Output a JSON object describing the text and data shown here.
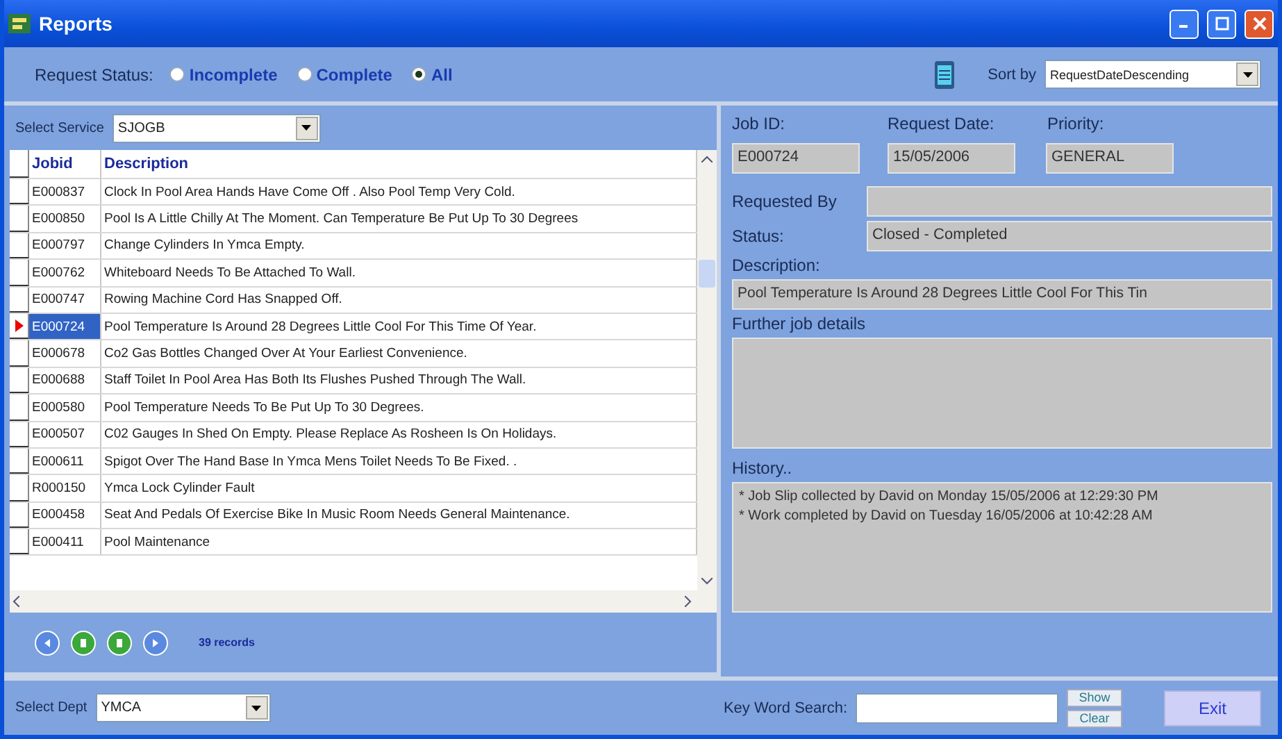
{
  "window": {
    "title": "Reports"
  },
  "request_status": {
    "label": "Request Status:",
    "options": [
      {
        "label": "Incomplete",
        "selected": false
      },
      {
        "label": "Complete",
        "selected": false
      },
      {
        "label": "All",
        "selected": true
      }
    ]
  },
  "sort": {
    "label": "Sort by",
    "value": "RequestDateDescending"
  },
  "service": {
    "label": "Select Service",
    "value": "SJOGB"
  },
  "table": {
    "columns": [
      "Jobid",
      "Description"
    ],
    "rows": [
      {
        "jobid": "E000837",
        "description": "Clock In Pool Area Hands Have Come Off .  Also Pool Temp Very Cold.",
        "selected": false
      },
      {
        "jobid": "E000850",
        "description": "Pool Is A Little Chilly At The Moment.  Can Temperature Be Put Up To 30 Degrees",
        "selected": false
      },
      {
        "jobid": "E000797",
        "description": "Change Cylinders In Ymca Empty.",
        "selected": false
      },
      {
        "jobid": "E000762",
        "description": "Whiteboard Needs To Be Attached To Wall.",
        "selected": false
      },
      {
        "jobid": "E000747",
        "description": "Rowing Machine Cord Has Snapped Off.",
        "selected": false
      },
      {
        "jobid": "E000724",
        "description": "Pool Temperature Is Around 28 Degrees Little Cool For This Time Of Year.",
        "selected": true
      },
      {
        "jobid": "E000678",
        "description": "Co2 Gas Bottles Changed Over At Your Earliest Convenience.",
        "selected": false
      },
      {
        "jobid": "E000688",
        "description": "Staff Toilet In Pool Area Has Both Its Flushes Pushed Through The Wall.",
        "selected": false
      },
      {
        "jobid": "E000580",
        "description": "Pool Temperature Needs To Be Put Up To 30 Degrees.",
        "selected": false
      },
      {
        "jobid": "E000507",
        "description": "C02 Gauges In Shed On Empty.  Please Replace As Rosheen Is On Holidays.",
        "selected": false
      },
      {
        "jobid": "E000611",
        "description": "Spigot Over The Hand Base In Ymca Mens Toilet Needs To Be Fixed. .",
        "selected": false
      },
      {
        "jobid": "R000150",
        "description": "Ymca Lock Cylinder Fault",
        "selected": false
      },
      {
        "jobid": "E000458",
        "description": "Seat And Pedals Of Exercise Bike In Music Room Needs General Maintenance.",
        "selected": false
      },
      {
        "jobid": "E000411",
        "description": "Pool Maintenance",
        "selected": false
      }
    ]
  },
  "record_count": "39 records",
  "details": {
    "job_id_label": "Job ID:",
    "job_id": "E000724",
    "request_date_label": "Request Date:",
    "request_date": "15/05/2006",
    "priority_label": "Priority:",
    "priority": "GENERAL",
    "requested_by_label": "Requested By",
    "status_label": "Status:",
    "status": "Closed - Completed",
    "description_label": "Description:",
    "description": "Pool Temperature Is Around 28 Degrees Little Cool For This Tin",
    "further_label": "Further job details",
    "history_label": "History..",
    "history": [
      "* Job Slip collected by David on Monday 15/05/2006 at 12:29:30 PM",
      "* Work completed by David on Tuesday 16/05/2006 at 10:42:28 AM"
    ]
  },
  "dept": {
    "label": "Select Dept",
    "value": "YMCA"
  },
  "keyword": {
    "label": "Key Word Search:"
  },
  "buttons": {
    "show": "Show",
    "clear": "Clear",
    "exit": "Exit"
  }
}
